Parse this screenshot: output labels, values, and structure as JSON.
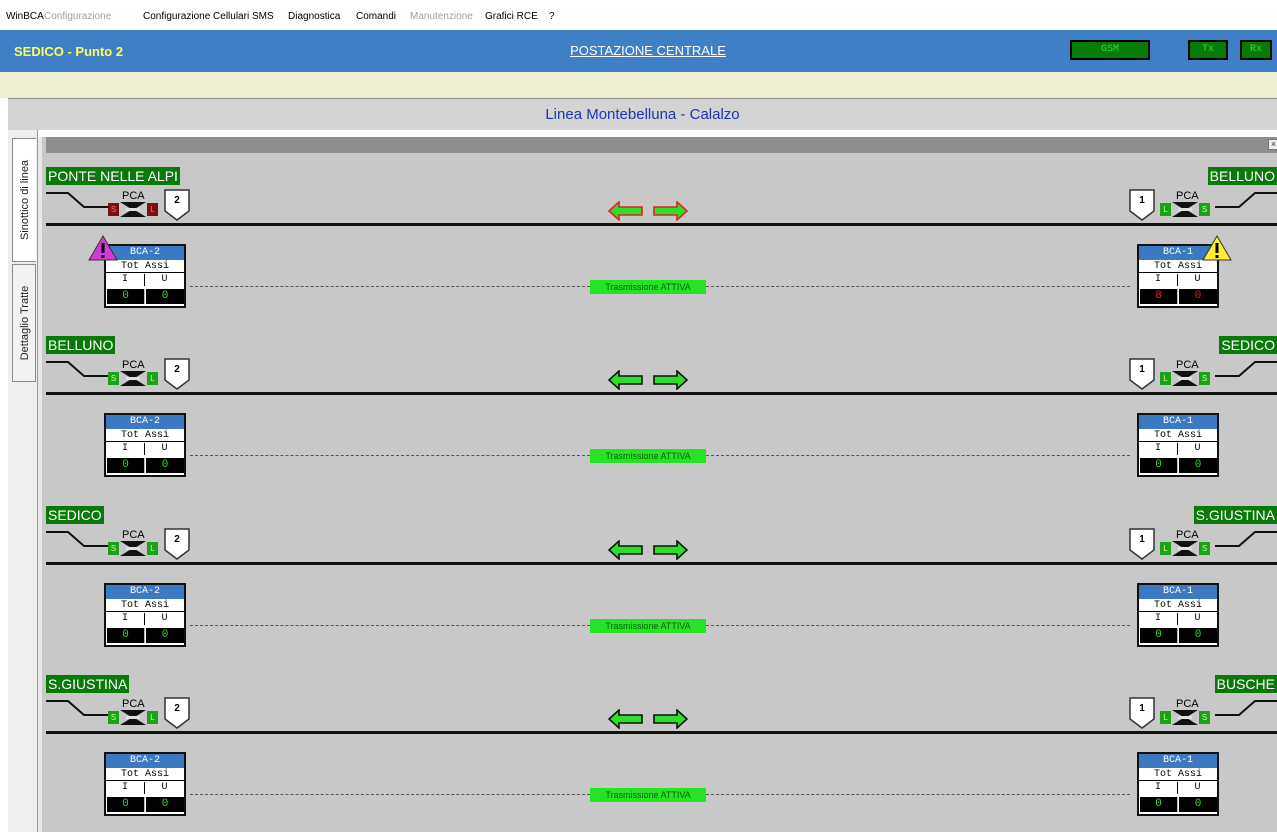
{
  "menu": {
    "items": [
      {
        "label": "WinBCA",
        "enabled": true
      },
      {
        "label": "Configurazione",
        "enabled": false
      },
      {
        "label": "Configurazione Cellulari SMS",
        "enabled": true
      },
      {
        "label": "Diagnostica",
        "enabled": true
      },
      {
        "label": "Comandi",
        "enabled": true
      },
      {
        "label": "Manutenzione",
        "enabled": false
      },
      {
        "label": "Grafici RCE",
        "enabled": true
      },
      {
        "label": "?",
        "enabled": true
      }
    ]
  },
  "header": {
    "site": "SEDICO - Punto 2",
    "postazione": "POSTAZIONE CENTRALE",
    "gsm": "GSM",
    "tx": "Tx",
    "rx": "Rx"
  },
  "linea_title": "Linea Montebelluna - Calalzo",
  "tabs": {
    "sinottico": "Sinottico di linea",
    "dettaglio": "Dettaglio Tratte"
  },
  "panel": {
    "close_icon": "close-icon",
    "pca_label": "PCA",
    "tot_assi": "Tot Assi",
    "in_label": "I",
    "out_label": "U",
    "sections": [
      {
        "left_station": "PONTE NELLE ALPI",
        "right_station": "BELLUNO",
        "left_shield": "2",
        "right_shield": "1",
        "left_sq": [
          "S",
          "L"
        ],
        "right_sq": [
          "L",
          "S"
        ],
        "left_sq_state": "alarm",
        "arrow_state": "alarm",
        "left_bca": {
          "name": "BCA-2",
          "in": "0",
          "out": "0",
          "warning": "magenta"
        },
        "right_bca": {
          "name": "BCA-1",
          "in": "8",
          "out": "0",
          "warning": "yellow"
        },
        "transmission": "Trasmissione ATTIVA"
      },
      {
        "left_station": "BELLUNO",
        "right_station": "SEDICO",
        "left_shield": "2",
        "right_shield": "1",
        "left_sq": [
          "S",
          "L"
        ],
        "right_sq": [
          "L",
          "S"
        ],
        "left_sq_state": "ok",
        "arrow_state": "ok",
        "left_bca": {
          "name": "BCA-2",
          "in": "0",
          "out": "0",
          "warning": ""
        },
        "right_bca": {
          "name": "BCA-1",
          "in": "0",
          "out": "0",
          "warning": ""
        },
        "transmission": "Trasmissione ATTIVA"
      },
      {
        "left_station": "SEDICO",
        "right_station": "S.GIUSTINA",
        "left_shield": "2",
        "right_shield": "1",
        "left_sq": [
          "S",
          "L"
        ],
        "right_sq": [
          "L",
          "S"
        ],
        "left_sq_state": "ok",
        "arrow_state": "ok",
        "left_bca": {
          "name": "BCA-2",
          "in": "0",
          "out": "0",
          "warning": ""
        },
        "right_bca": {
          "name": "BCA-1",
          "in": "0",
          "out": "0",
          "warning": ""
        },
        "transmission": "Trasmissione ATTIVA"
      },
      {
        "left_station": "S.GIUSTINA",
        "right_station": "BUSCHE",
        "left_shield": "2",
        "right_shield": "1",
        "left_sq": [
          "S",
          "L"
        ],
        "right_sq": [
          "L",
          "S"
        ],
        "left_sq_state": "ok",
        "arrow_state": "ok",
        "left_bca": {
          "name": "BCA-2",
          "in": "0",
          "out": "0",
          "warning": ""
        },
        "right_bca": {
          "name": "BCA-1",
          "in": "0",
          "out": "0",
          "warning": ""
        },
        "transmission": "Trasmissione ATTIVA"
      }
    ]
  },
  "colors": {
    "header_bg": "#3f7fc5",
    "site_text": "#ffff60",
    "station_bg": "#097a0a",
    "ok_green": "#26e326",
    "alarm_red": "#e52222",
    "bca_header": "#3b79c3"
  }
}
